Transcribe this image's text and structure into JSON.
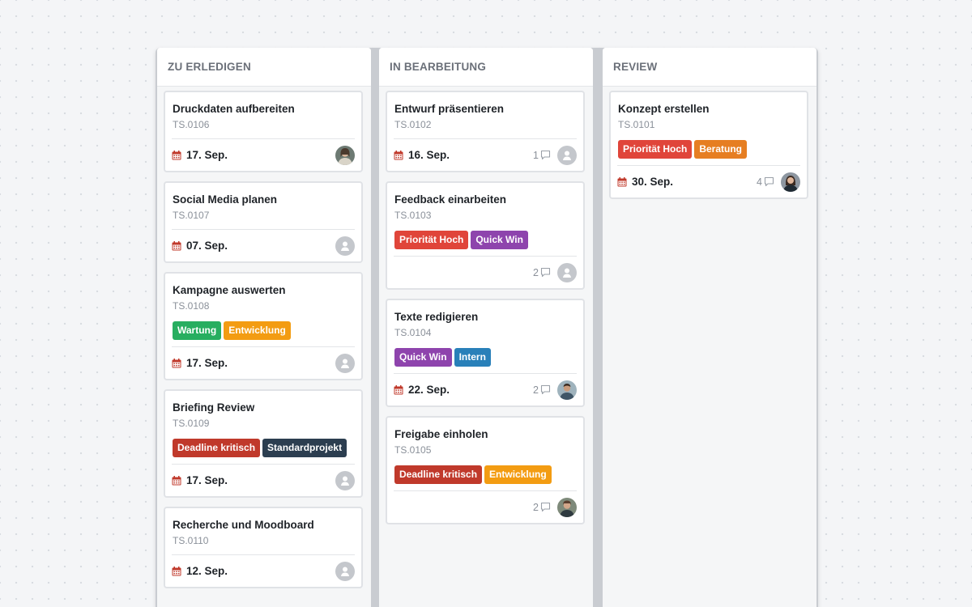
{
  "colors": {
    "red": "#e0453a",
    "dark_red": "#c0392b",
    "orange": "#f39c12",
    "orange2": "#e67e22",
    "green": "#27ae60",
    "purple": "#8e44ad",
    "blue": "#2980b9",
    "navy": "#2c3e50",
    "calendar": "#c0392b"
  },
  "columns": [
    {
      "title": "ZU ERLEDIGEN",
      "cards": [
        {
          "title": "Druckdaten aufbereiten",
          "id": "TS.0106",
          "tags": [],
          "due": "17. Sep.",
          "comments": "",
          "avatar": "photo-a"
        },
        {
          "title": "Social Media planen",
          "id": "TS.0107",
          "tags": [],
          "due": "07. Sep.",
          "comments": "",
          "avatar": "placeholder"
        },
        {
          "title": "Kampagne auswerten",
          "id": "TS.0108",
          "tags": [
            {
              "label": "Wartung",
              "color": "#27ae60"
            },
            {
              "label": "Entwicklung",
              "color": "#f39c12"
            }
          ],
          "due": "17. Sep.",
          "comments": "",
          "avatar": "placeholder"
        },
        {
          "title": "Briefing Review",
          "id": "TS.0109",
          "tags": [
            {
              "label": "Deadline kritisch",
              "color": "#c0392b"
            },
            {
              "label": "Standardprojekt",
              "color": "#2c3e50"
            }
          ],
          "due": "17. Sep.",
          "comments": "",
          "avatar": "placeholder"
        },
        {
          "title": "Recherche und Moodboard",
          "id": "TS.0110",
          "tags": [],
          "due": "12. Sep.",
          "comments": "",
          "avatar": "placeholder"
        }
      ]
    },
    {
      "title": "IN BEARBEITUNG",
      "cards": [
        {
          "title": "Entwurf präsentieren",
          "id": "TS.0102",
          "tags": [],
          "due": "16. Sep.",
          "comments": "1",
          "avatar": "placeholder"
        },
        {
          "title": "Feedback einarbeiten",
          "id": "TS.0103",
          "tags": [
            {
              "label": "Priorität Hoch",
              "color": "#e0453a"
            },
            {
              "label": "Quick Win",
              "color": "#8e44ad"
            }
          ],
          "due": "",
          "comments": "2",
          "avatar": "placeholder"
        },
        {
          "title": "Texte redigieren",
          "id": "TS.0104",
          "tags": [
            {
              "label": "Quick Win",
              "color": "#8e44ad"
            },
            {
              "label": "Intern",
              "color": "#2980b9"
            }
          ],
          "due": "22. Sep.",
          "comments": "2",
          "avatar": "photo-b"
        },
        {
          "title": "Freigabe einholen",
          "id": "TS.0105",
          "tags": [
            {
              "label": "Deadline kritisch",
              "color": "#c0392b"
            },
            {
              "label": "Entwicklung",
              "color": "#f39c12"
            }
          ],
          "due": "",
          "comments": "2",
          "avatar": "photo-c"
        }
      ]
    },
    {
      "title": "REVIEW",
      "cards": [
        {
          "title": "Konzept erstellen",
          "id": "TS.0101",
          "tags": [
            {
              "label": "Priorität Hoch",
              "color": "#e0453a"
            },
            {
              "label": "Beratung",
              "color": "#e67e22"
            }
          ],
          "due": "30. Sep.",
          "comments": "4",
          "avatar": "photo-d"
        }
      ]
    }
  ]
}
